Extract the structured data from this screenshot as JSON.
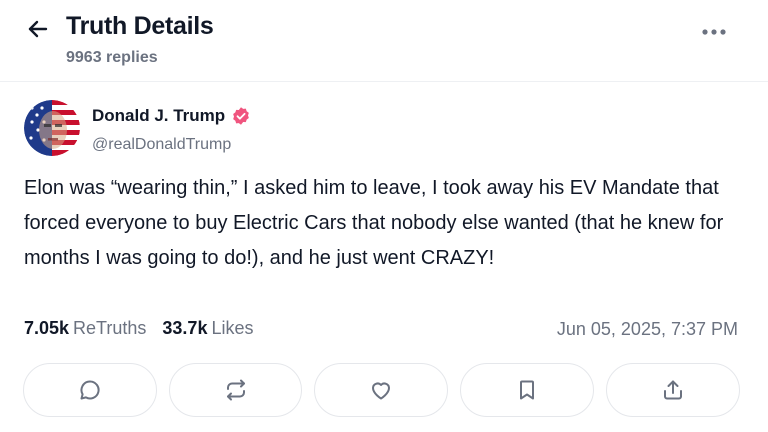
{
  "header": {
    "title": "Truth Details",
    "replies": "9963 replies"
  },
  "author": {
    "name": "Donald J. Trump",
    "handle": "@realDonaldTrump"
  },
  "post": {
    "text": "Elon was “wearing thin,” I asked him to leave, I took away his EV Mandate that forced everyone to buy Electric Cars that nobody else wanted (that he knew for months I was going to do!), and he just went CRAZY!"
  },
  "stats": {
    "retruths_count": "7.05k",
    "retruths_label": "ReTruths",
    "likes_count": "33.7k",
    "likes_label": "Likes",
    "timestamp": "Jun 05, 2025, 7:37 PM"
  },
  "icons": {
    "back": "arrow-left-icon",
    "more": "more-horizontal-icon",
    "verified": "verified-badge-icon",
    "reply": "comment-icon",
    "retruth": "repost-icon",
    "like": "heart-icon",
    "bookmark": "bookmark-icon",
    "share": "share-icon"
  },
  "colors": {
    "verified": "#f0557f",
    "muted": "#6b7280",
    "text": "#111827",
    "border": "#e5e7eb"
  }
}
